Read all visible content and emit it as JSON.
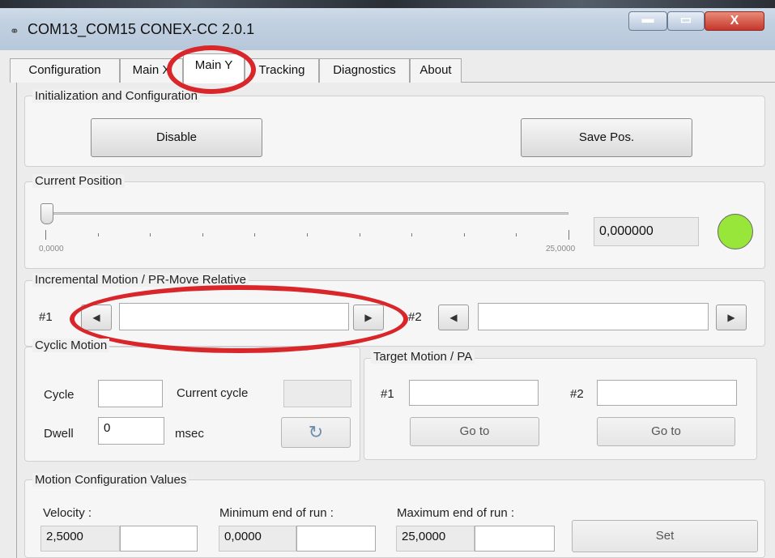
{
  "window": {
    "title": "COM13_COM15  CONEX-CC 2.0.1",
    "icon": "link-icon",
    "controls": {
      "minimize": "▬",
      "maximize": "▭",
      "close": "X"
    }
  },
  "tabs": [
    "Configuration",
    "Main X",
    "Main Y",
    "Tracking",
    "Diagnostics",
    "About"
  ],
  "active_tab": "Main Y",
  "init_group": {
    "legend": "Initialization and Configuration",
    "disable_label": "Disable",
    "save_label": "Save Pos."
  },
  "position_group": {
    "legend": "Current Position",
    "slider_min": "0,0000",
    "slider_max": "25,0000",
    "slider_value_fraction": 0,
    "value": "0,000000",
    "status_color": "#99e63b"
  },
  "incremental_group": {
    "legend": "Incremental Motion / PR-Move Relative",
    "label1": "#1",
    "label2": "#2",
    "value1": "",
    "value2": "",
    "left_arrow": "◀",
    "right_arrow": "▶"
  },
  "cyclic_group": {
    "legend": "Cyclic Motion",
    "cycle_label": "Cycle",
    "cycle_value": "",
    "current_cycle_label": "Current cycle",
    "current_cycle_value": "",
    "dwell_label": "Dwell",
    "dwell_value": "0",
    "dwell_unit": "msec",
    "reset_icon": "↻"
  },
  "target_group": {
    "legend": "Target Motion / PA",
    "label1": "#1",
    "label2": "#2",
    "value1": "",
    "value2": "",
    "goto1": "Go to",
    "goto2": "Go to"
  },
  "config_group": {
    "legend": "Motion Configuration Values",
    "velocity_label": "Velocity :",
    "velocity_value": "2,5000",
    "velocity_input": "",
    "min_label": "Minimum end of run :",
    "min_value": "0,0000",
    "min_input": "",
    "max_label": "Maximum end of run :",
    "max_value": "25,0000",
    "max_input": "",
    "set_label": "Set"
  },
  "annotations": {
    "highlight_color": "#d8262a"
  }
}
